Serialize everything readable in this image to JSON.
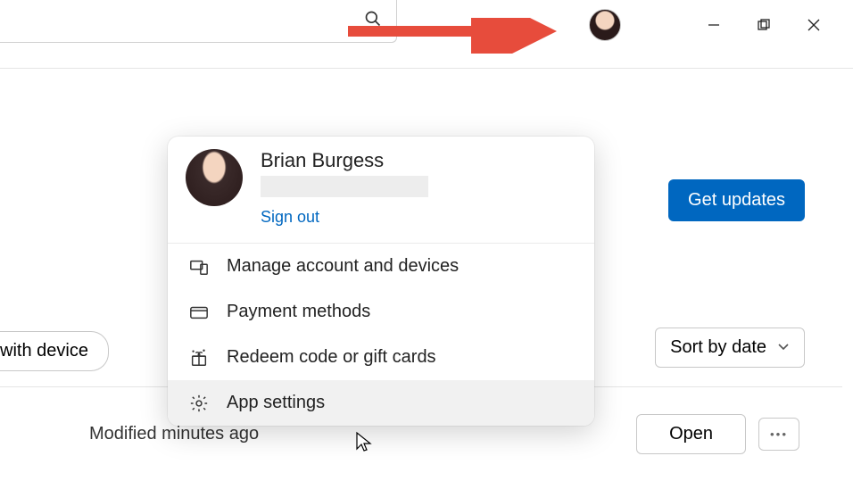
{
  "titlebar": {
    "search_icon": "search-icon"
  },
  "user": {
    "name": "Brian Burgess",
    "sign_out_label": "Sign out"
  },
  "menu": {
    "items": [
      {
        "icon": "devices-icon",
        "label": "Manage account and devices"
      },
      {
        "icon": "card-icon",
        "label": "Payment methods"
      },
      {
        "icon": "gift-icon",
        "label": "Redeem code or gift cards"
      },
      {
        "icon": "gear-icon",
        "label": "App settings"
      }
    ]
  },
  "buttons": {
    "get_updates": "Get updates",
    "with_device": "with device",
    "sort_by_date": "Sort by date",
    "open": "Open",
    "more": "•••"
  },
  "status": {
    "modified": "Modified minutes ago"
  },
  "colors": {
    "accent": "#0067c0",
    "arrow": "#e74c3c"
  }
}
